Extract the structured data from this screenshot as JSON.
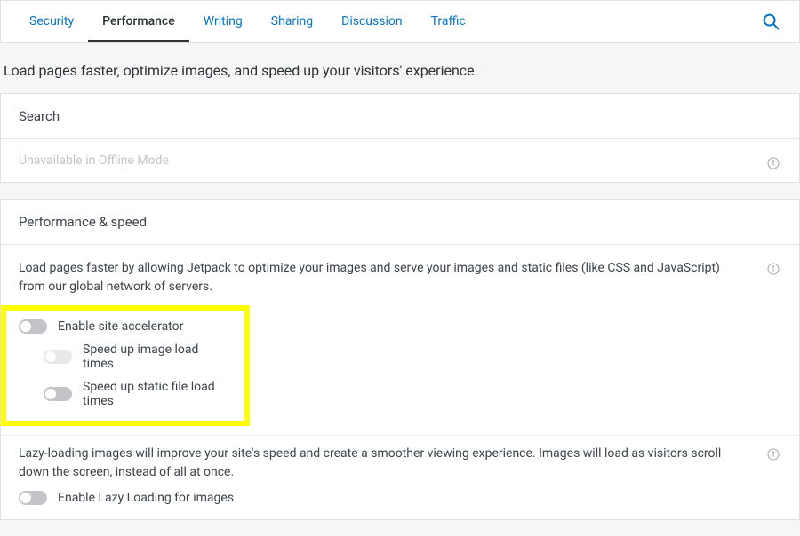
{
  "tabs": {
    "security": "Security",
    "performance": "Performance",
    "writing": "Writing",
    "sharing": "Sharing",
    "discussion": "Discussion",
    "traffic": "Traffic"
  },
  "intro": "Load pages faster, optimize images, and speed up your visitors' experience.",
  "search_card": {
    "title": "Search",
    "unavailable": "Unavailable in Offline Mode"
  },
  "perf_card": {
    "title": "Performance & speed",
    "desc": "Load pages faster by allowing Jetpack to optimize your images and serve your images and static files (like CSS and JavaScript) from our global network of servers.",
    "toggle_accelerator": "Enable site accelerator",
    "toggle_images": "Speed up image load times",
    "toggle_static": "Speed up static file load times",
    "lazy_desc": "Lazy-loading images will improve your site's speed and create a smoother viewing experience. Images will load as visitors scroll down the screen, instead of all at once.",
    "toggle_lazy": "Enable Lazy Loading for images"
  }
}
